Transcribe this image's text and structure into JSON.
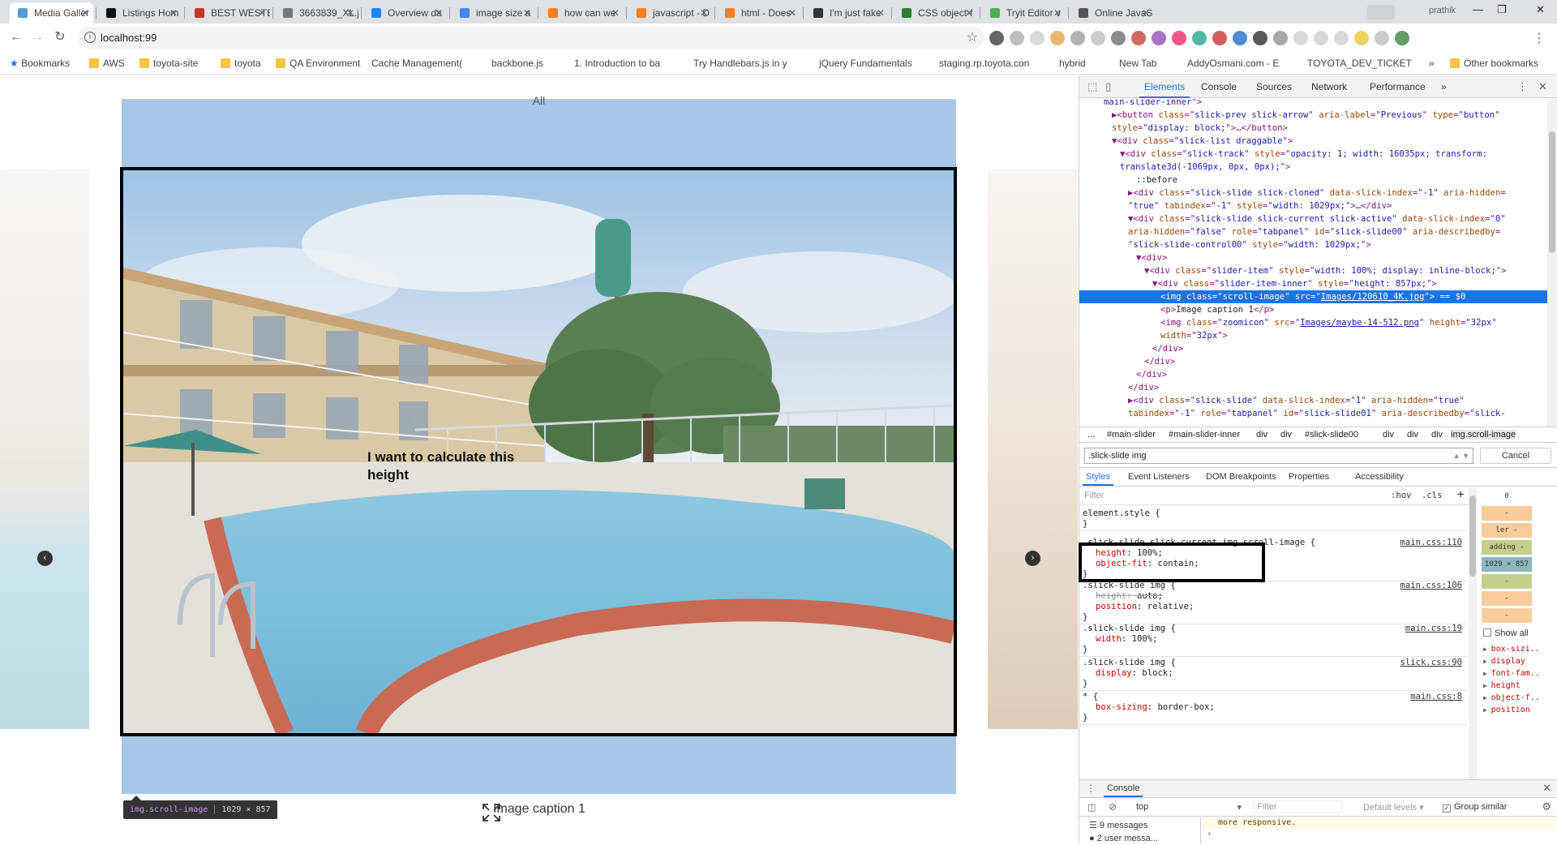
{
  "browser": {
    "tabs": [
      {
        "label": "Media Galler",
        "color": "#5b9bd5",
        "active": true
      },
      {
        "label": "Listings Hom",
        "color": "#111111"
      },
      {
        "label": "BEST WESTER",
        "color": "#c0392b"
      },
      {
        "label": "3663839_XL.j",
        "color": "#777777"
      },
      {
        "label": "Overview da",
        "color": "#1e88e5"
      },
      {
        "label": "image size a",
        "color": "#4285f4"
      },
      {
        "label": "how can we",
        "color": "#f48024"
      },
      {
        "label": "javascript - D",
        "color": "#f48024"
      },
      {
        "label": "html - Does",
        "color": "#f48024"
      },
      {
        "label": "I'm just fake",
        "color": "#333333"
      },
      {
        "label": "CSS object-f",
        "color": "#2e7d32"
      },
      {
        "label": "Tryit Editor v",
        "color": "#4caf50"
      },
      {
        "label": "Online JavaS",
        "color": "#555555"
      }
    ],
    "profile": "prathik",
    "url": "localhost:99",
    "bookmarks": [
      {
        "label": "Bookmarks",
        "kind": "star"
      },
      {
        "label": "AWS",
        "kind": "folder"
      },
      {
        "label": "toyota-site",
        "kind": "folder"
      },
      {
        "label": "toyota",
        "kind": "folder"
      },
      {
        "label": "QA Environment",
        "kind": "folder"
      },
      {
        "label": "Cache Management(",
        "kind": "page"
      },
      {
        "label": "backbone.js",
        "kind": "page"
      },
      {
        "label": "1. Introduction to ba",
        "kind": "page"
      },
      {
        "label": "Try Handlebars.js in y",
        "kind": "page"
      },
      {
        "label": "jQuery Fundamentals",
        "kind": "page"
      },
      {
        "label": "staging.rp.toyota.con",
        "kind": "page"
      },
      {
        "label": "hybrid",
        "kind": "page"
      },
      {
        "label": "New Tab",
        "kind": "page"
      },
      {
        "label": "AddyOsmani.com - E",
        "kind": "page"
      },
      {
        "label": "TOYOTA_DEV_TICKET",
        "kind": "page"
      },
      {
        "label": "»",
        "kind": "more"
      },
      {
        "label": "Other bookmarks",
        "kind": "folder"
      }
    ]
  },
  "page": {
    "filter_label": "All",
    "annotation": "I want to calculate this height",
    "caption": "Image caption 1",
    "tooltip_tag": "img.scroll-image",
    "tooltip_dims": "1029 × 857",
    "prev_arrow": "‹",
    "next_arrow": "›"
  },
  "devtools": {
    "tabs": [
      "Elements",
      "Console",
      "Sources",
      "Network",
      "Performance",
      "»"
    ],
    "dom_lines": [
      {
        "indent": 4,
        "html": "<span class='av'>main-slider-inner</span><span class='tag'>\">"
      },
      {
        "indent": 5,
        "html": "▶<span class='tag'>&lt;button</span> <span class='an'>class</span>=\"<span class='av'>slick-prev slick-arrow</span>\" <span class='an'>aria-label</span>=\"<span class='av'>Previous</span>\" <span class='an'>type</span>=\"<span class='av'>button</span>\""
      },
      {
        "indent": 5,
        "html": "<span class='an'>style</span>=\"<span class='av'>display: block;</span>\"&gt;…&lt;/button&gt;"
      },
      {
        "indent": 5,
        "html": "▼<span class='tag'>&lt;div</span> <span class='an'>class</span>=\"<span class='av'>slick-list draggable</span>\"&gt;"
      },
      {
        "indent": 6,
        "html": "▼<span class='tag'>&lt;div</span> <span class='an'>class</span>=\"<span class='av'>slick-track</span>\" <span class='an'>style</span>=\"<span class='av'>opacity: 1; width: 16035px; transform:</span>"
      },
      {
        "indent": 6,
        "html": "<span class='av'>translate3d(-1069px, 0px, 0px);</span>\"&gt;"
      },
      {
        "indent": 8,
        "html": "<span class='tx'>::before</span>"
      },
      {
        "indent": 7,
        "html": "▶<span class='tag'>&lt;div</span> <span class='an'>class</span>=\"<span class='av'>slick-slide slick-cloned</span>\" <span class='an'>data-slick-index</span>=\"<span class='av'>-1</span>\" <span class='an'>aria-hidden</span>="
      },
      {
        "indent": 7,
        "html": "\"<span class='av'>true</span>\" <span class='an'>tabindex</span>=\"<span class='av'>-1</span>\" <span class='an'>style</span>=\"<span class='av'>width: 1029px;</span>\"&gt;…&lt;/div&gt;"
      },
      {
        "indent": 7,
        "html": "▼<span class='tag'>&lt;div</span> <span class='an'>class</span>=\"<span class='av'>slick-slide slick-current slick-active</span>\" <span class='an'>data-slick-index</span>=\"<span class='av'>0</span>\""
      },
      {
        "indent": 7,
        "html": "<span class='an'>aria-hidden</span>=\"<span class='av'>false</span>\" <span class='an'>role</span>=\"<span class='av'>tabpanel</span>\" <span class='an'>id</span>=\"<span class='av'>slick-slide00</span>\" <span class='an'>aria-describedby</span>="
      },
      {
        "indent": 7,
        "html": "\"<span class='av'>slick-slide-control00</span>\" <span class='an'>style</span>=\"<span class='av'>width: 1029px;</span>\"&gt;"
      },
      {
        "indent": 8,
        "html": "▼<span class='tag'>&lt;div&gt;</span>"
      },
      {
        "indent": 9,
        "html": "▼<span class='tag'>&lt;div</span> <span class='an'>class</span>=\"<span class='av'>slider-item</span>\" <span class='an'>style</span>=\"<span class='av'>width: 100%; display: inline-block;</span>\"&gt;"
      },
      {
        "indent": 10,
        "html": "▼<span class='tag'>&lt;div</span> <span class='an'>class</span>=\"<span class='av'>slider-item-inner</span>\" <span class='an'>style</span>=\"<span class='av'>height: 857px;</span>\"&gt;"
      },
      {
        "indent": 11,
        "sel": true,
        "html": "<span class='tag'>&lt;img</span> <span class='an'>class</span>=\"<span class='av'>scroll-image</span>\" <span class='an'>src</span>=\"<span class='link'>Images/120610_4K.jpg</span>\"&gt; == $0"
      },
      {
        "indent": 11,
        "html": "<span class='tag'>&lt;p&gt;</span><span class='tx'>Image caption 1</span><span class='tag'>&lt;/p&gt;</span>"
      },
      {
        "indent": 11,
        "html": "<span class='tag'>&lt;img</span> <span class='an'>class</span>=\"<span class='av'>zoomicon</span>\" <span class='an'>src</span>=\"<span class='link'>Images/maybe-14-512.png</span>\" <span class='an'>height</span>=\"<span class='av'>32px</span>\""
      },
      {
        "indent": 11,
        "html": "<span class='an'>width</span>=\"<span class='av'>32px</span>\"&gt;"
      },
      {
        "indent": 10,
        "html": "<span class='tag'>&lt;/div&gt;</span>"
      },
      {
        "indent": 9,
        "html": "<span class='tag'>&lt;/div&gt;</span>"
      },
      {
        "indent": 8,
        "html": "<span class='tag'>&lt;/div&gt;</span>"
      },
      {
        "indent": 7,
        "html": "<span class='tag'>&lt;/div&gt;</span>"
      },
      {
        "indent": 7,
        "html": "▶<span class='tag'>&lt;div</span> <span class='an'>class</span>=\"<span class='av'>slick-slide</span>\" <span class='an'>data-slick-index</span>=\"<span class='av'>1</span>\" <span class='an'>aria-hidden</span>=\"<span class='av'>true</span>\""
      },
      {
        "indent": 7,
        "html": "<span class='an'>tabindex</span>=\"<span class='av'>-1</span>\" <span class='an'>role</span>=\"<span class='av'>tabpanel</span>\" <span class='an'>id</span>=\"<span class='av'>slick-slide01</span>\" <span class='an'>aria-describedby</span>=\"<span class='av'>slick-</span>"
      }
    ],
    "breadcrumbs": [
      "...",
      "#main-slider",
      "#main-slider-inner",
      "div",
      "div",
      "#slick-slide00",
      "div",
      "div",
      "div",
      "img.scroll-image"
    ],
    "search_value": ".slick-slide img",
    "search_cancel": "Cancel",
    "style_tabs": [
      "Styles",
      "Event Listeners",
      "DOM Breakpoints",
      "Properties",
      "Accessibility"
    ],
    "styles_filter_placeholder": "Filter",
    "hov": ":hov",
    "cls": ".cls",
    "rules": [
      {
        "selector": "element.style {",
        "props": [],
        "source": ""
      },
      {
        "selector": ".slick-slide.slick-current img.scroll-image {",
        "props": [
          [
            "height",
            "100%;"
          ],
          [
            "object-fit",
            "contain;"
          ]
        ],
        "source": "main.css:110"
      },
      {
        "selector": ".slick-slide img {",
        "props": [
          [
            "height",
            "auto;",
            true
          ],
          [
            "position",
            "relative;"
          ]
        ],
        "source": "main.css:106"
      },
      {
        "selector": ".slick-slide img {",
        "props": [
          [
            "width",
            "100%;"
          ]
        ],
        "source": "main.css:19"
      },
      {
        "selector": ".slick-slide img {",
        "props": [
          [
            "display",
            "block;"
          ]
        ],
        "source": "slick.css:90"
      },
      {
        "selector": "* {",
        "props": [
          [
            "box-sizing",
            "border-box;"
          ]
        ],
        "source": "main.css:8"
      }
    ],
    "box_model": [
      "0",
      "-",
      "ler -",
      "adding -",
      "1029 × 857",
      "-",
      "-",
      "-"
    ],
    "show_all": "Show all",
    "computed_props": [
      "box-sizi..",
      "display",
      "font-fam..",
      "height",
      "object-f..",
      "position"
    ],
    "console": {
      "title": "Console",
      "context": "top",
      "filter_placeholder": "Filter",
      "levels": "Default levels ▾",
      "group_similar": "Group similar",
      "messages": "9 messages",
      "user_messages": "2 user messa...",
      "warning": "more responsive."
    }
  }
}
